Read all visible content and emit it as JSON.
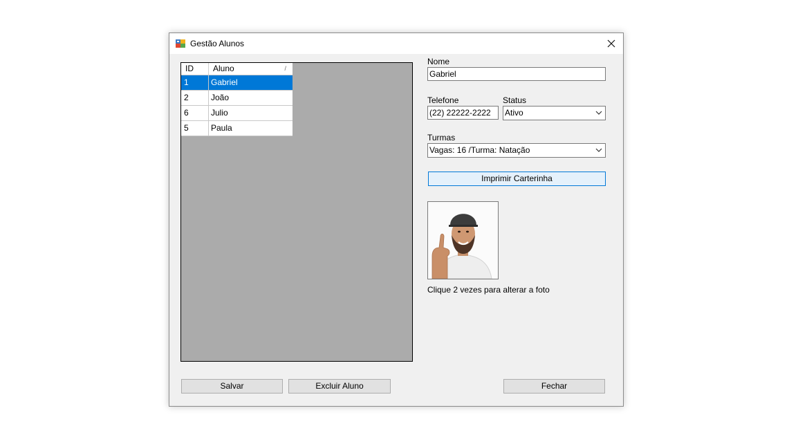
{
  "window": {
    "title": "Gestão Alunos"
  },
  "grid": {
    "columns": [
      "ID",
      "Aluno"
    ],
    "rows": [
      {
        "id": "1",
        "name": "Gabriel",
        "selected": true
      },
      {
        "id": "2",
        "name": "João"
      },
      {
        "id": "6",
        "name": "Julio"
      },
      {
        "id": "5",
        "name": "Paula"
      }
    ]
  },
  "form": {
    "nome_label": "Nome",
    "nome_value": "Gabriel",
    "telefone_label": "Telefone",
    "telefone_value": "(22) 22222-2222",
    "status_label": "Status",
    "status_value": "Ativo",
    "turmas_label": "Turmas",
    "turmas_value": "Vagas: 16 /Turma: Natação",
    "print_button": "Imprimir Carterinha",
    "photo_hint": "Clique 2 vezes para alterar a foto"
  },
  "footer": {
    "save_label": "Salvar",
    "delete_label": "Excluir Aluno",
    "close_label": "Fechar"
  },
  "colors": {
    "selection": "#0078d7",
    "grid_bg": "#ababab",
    "window_bg": "#f0f0f0",
    "accent_button": "#e5f1fb"
  }
}
